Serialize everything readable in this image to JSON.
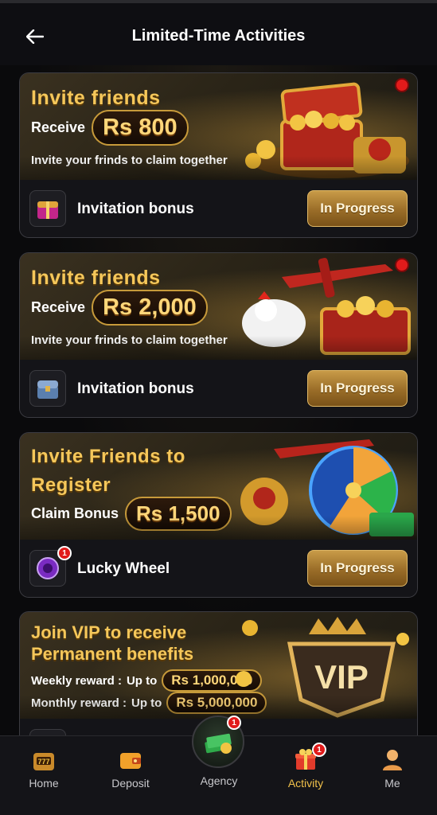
{
  "header": {
    "title": "Limited-Time Activities"
  },
  "cards": [
    {
      "title": "Invite friends",
      "receive_label": "Receive",
      "amount": "Rs 800",
      "subtitle": "Invite your frinds to claim together",
      "footer_label": "Invitation bonus",
      "button": "In Progress"
    },
    {
      "title": "Invite friends",
      "receive_label": "Receive",
      "amount": "Rs 2,000",
      "subtitle": "Invite your frinds to claim together",
      "footer_label": "Invitation bonus",
      "button": "In Progress"
    },
    {
      "title_line1": "Invite Friends to",
      "title_line2": "Register",
      "claim_label": "Claim Bonus",
      "amount": "Rs 1,500",
      "footer_label": "Lucky Wheel",
      "footer_badge": "1",
      "button": "In Progress"
    },
    {
      "title_line1": "Join VIP to receive",
      "title_line2": "Permanent benefits",
      "weekly_label": "Weekly reward :",
      "weekly_upto": "Up to",
      "weekly_amount": "Rs 1,000,000",
      "monthly_label": "Monthly reward :",
      "monthly_upto": "Up to",
      "monthly_amount": "Rs 5,000,000",
      "vip_text": "VIP"
    }
  ],
  "bottom_nav": {
    "home": "Home",
    "deposit": "Deposit",
    "agency": "Agency",
    "agency_badge": "1",
    "activity": "Activity",
    "activity_badge": "1",
    "me": "Me"
  },
  "colors": {
    "accent_gold": "#f5c75a",
    "active_nav": "#f0c04a",
    "badge_red": "#e11b1b"
  }
}
